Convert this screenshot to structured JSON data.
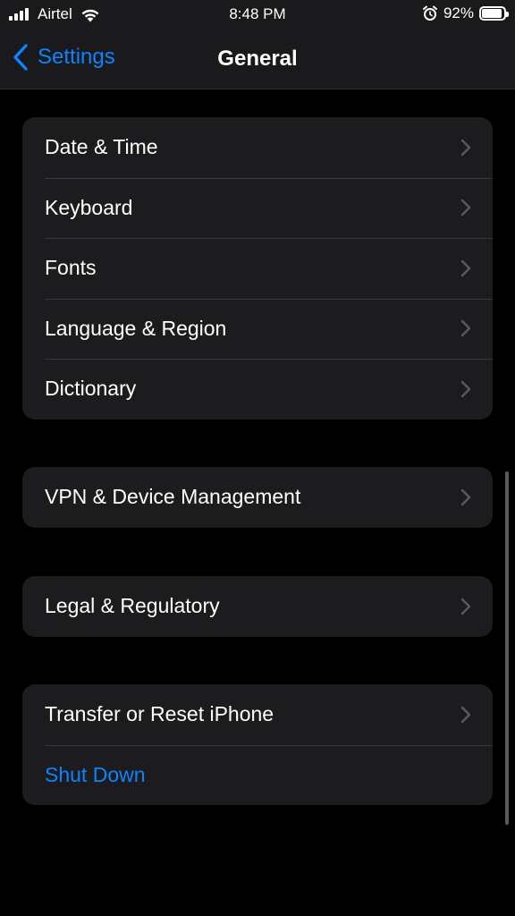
{
  "status_bar": {
    "carrier": "Airtel",
    "time": "8:48 PM",
    "battery_percent": "92%",
    "battery_level": 0.92
  },
  "nav": {
    "back_label": "Settings",
    "title": "General"
  },
  "groups": [
    {
      "rows": [
        {
          "label": "Date & Time",
          "chevron": true
        },
        {
          "label": "Keyboard",
          "chevron": true
        },
        {
          "label": "Fonts",
          "chevron": true
        },
        {
          "label": "Language & Region",
          "chevron": true
        },
        {
          "label": "Dictionary",
          "chevron": true
        }
      ]
    },
    {
      "rows": [
        {
          "label": "VPN & Device Management",
          "chevron": true
        }
      ]
    },
    {
      "rows": [
        {
          "label": "Legal & Regulatory",
          "chevron": true
        }
      ]
    },
    {
      "rows": [
        {
          "label": "Transfer or Reset iPhone",
          "chevron": true
        },
        {
          "label": "Shut Down",
          "chevron": false,
          "style": "destructive-blue"
        }
      ]
    }
  ],
  "colors": {
    "accent": "#0a84ff",
    "background": "#000000",
    "cell": "#1c1c1e",
    "separator": "#38383a",
    "chevron": "#5a5a5f"
  },
  "icons": {
    "back": "chevron-left-icon",
    "row": "chevron-right-icon",
    "wifi": "wifi-icon",
    "alarm": "alarm-clock-icon",
    "battery": "battery-icon",
    "signal": "cellular-signal-icon"
  }
}
